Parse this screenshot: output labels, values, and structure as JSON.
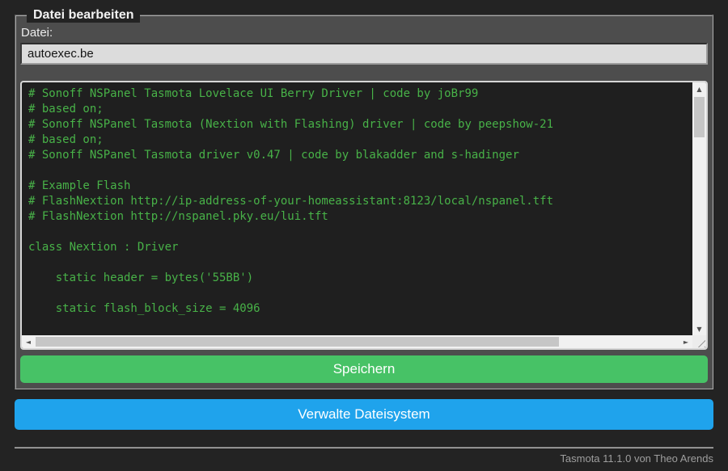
{
  "edit_file": {
    "legend": "Datei bearbeiten",
    "file_label": "Datei:",
    "filename_value": "autoexec.be",
    "save_button": "Speichern",
    "code_lines": [
      "# Sonoff NSPanel Tasmota Lovelace UI Berry Driver | code by joBr99",
      "# based on;",
      "# Sonoff NSPanel Tasmota (Nextion with Flashing) driver | code by peepshow-21",
      "# based on;",
      "# Sonoff NSPanel Tasmota driver v0.47 | code by blakadder and s-hadinger",
      "",
      "# Example Flash",
      "# FlashNextion http://ip-address-of-your-homeassistant:8123/local/nspanel.tft",
      "# FlashNextion http://nspanel.pky.eu/lui.tft",
      "",
      "class Nextion : Driver",
      "",
      "    static header = bytes('55BB')",
      "",
      "    static flash_block_size = 4096"
    ]
  },
  "actions": {
    "manage_filesystem_button": "Verwalte Dateisystem"
  },
  "footer": {
    "version_text": "Tasmota 11.1.0 von Theo Arends"
  },
  "icons": {
    "scroll_up": "▲",
    "scroll_down": "▼",
    "scroll_left": "◄",
    "scroll_right": "►"
  },
  "colors": {
    "page_background": "#232323",
    "fieldset_background": "#4d4d4d",
    "code_background": "#1f1f1f",
    "code_text_green": "#48b248",
    "save_button_green": "#47c266",
    "manage_button_blue": "#1fa3ec",
    "input_background": "#dcdcdc",
    "footer_text_gray": "#9e9e9e"
  }
}
